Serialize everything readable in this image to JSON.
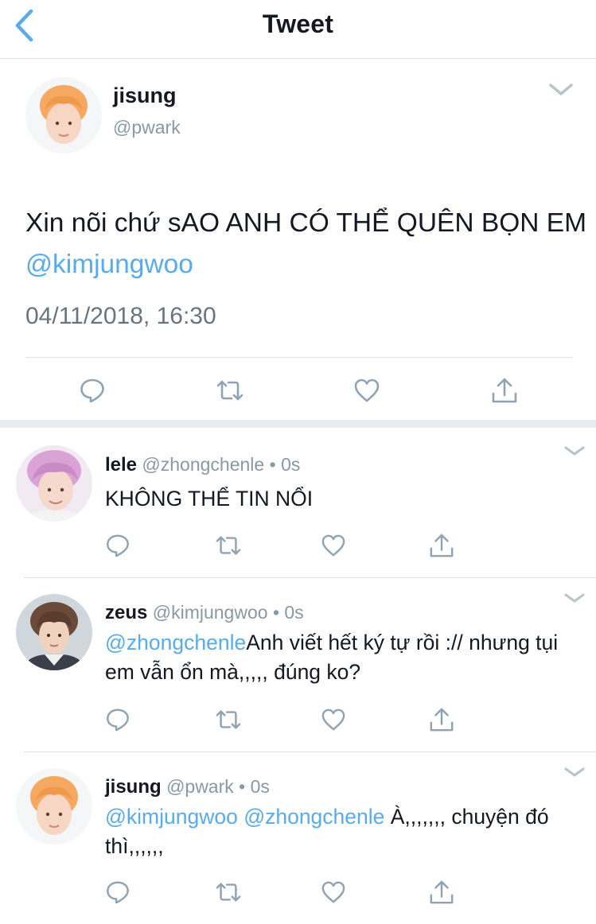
{
  "header": {
    "title": "Tweet"
  },
  "main_tweet": {
    "name": "jisung",
    "handle": "@pwark",
    "text": "Xin nõi chứ sAO ANH CÓ THỂ QUÊN BỌN EM ",
    "mention": "@kimjungwoo",
    "timestamp": "04/11/2018, 16:30",
    "avatar_hair_color": "#f5a860"
  },
  "replies": [
    {
      "name": "lele",
      "handle": "@zhongchenle",
      "time": "0s",
      "mention": "",
      "text": "KHÔNG THỂ TIN NỔI",
      "avatar_hair_color": "#d9a3d6"
    },
    {
      "name": "zeus",
      "handle": "@kimjungwoo",
      "time": "0s",
      "mention": "@zhongchenle",
      "text": "Anh viết hết ký tự rồi :// nhưng tụi em vẫn ổn mà,,,,, đúng ko?",
      "avatar_hair_color": "#6b4a3a"
    },
    {
      "name": "jisung",
      "handle": "@pwark",
      "time": "0s",
      "mention": "@kimjungwoo @zhongchenle",
      "text": " À,,,,,,, chuyện đó thì,,,,,,",
      "avatar_hair_color": "#f5a860"
    }
  ],
  "meta_separator": "•",
  "colors": {
    "accent": "#55acee",
    "icon": "#8fa3b3",
    "secondary_text": "#8899a6",
    "divider": "#d8dde1"
  },
  "icons": [
    "back-chevron-icon",
    "chevron-down-icon",
    "reply-icon",
    "retweet-icon",
    "like-heart-icon",
    "share-icon"
  ]
}
